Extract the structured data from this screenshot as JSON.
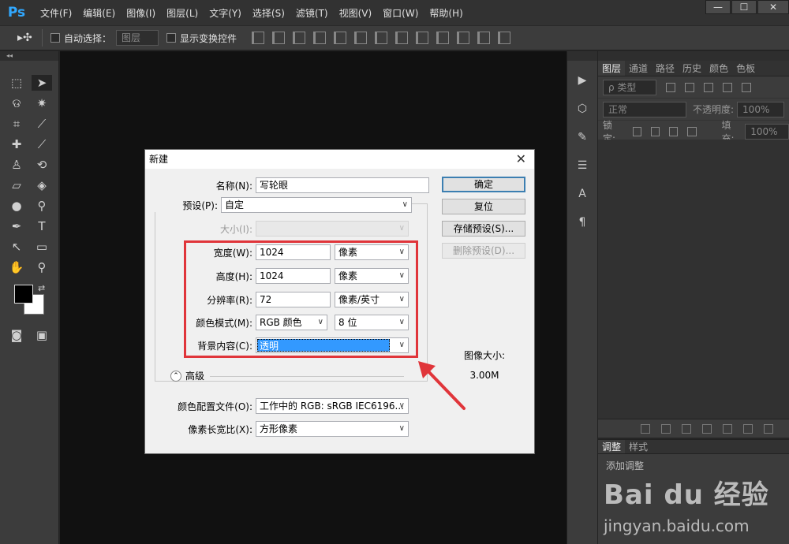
{
  "app": {
    "logo": "Ps",
    "menu": [
      "文件(F)",
      "编辑(E)",
      "图像(I)",
      "图层(L)",
      "文字(Y)",
      "选择(S)",
      "滤镜(T)",
      "视图(V)",
      "窗口(W)",
      "帮助(H)"
    ],
    "window_controls": [
      "—",
      "☐",
      "✕"
    ]
  },
  "options": {
    "tool_glyph": "▸✣",
    "auto_select_label": "自动选择：",
    "auto_select_value": "图层",
    "transform_label": "显示变换控件"
  },
  "layers_panel": {
    "tabs": [
      "图层",
      "通道",
      "路径",
      "历史",
      "颜色",
      "色板"
    ],
    "kind": "ρ 类型",
    "blend": "正常",
    "opacity_label": "不透明度:",
    "opacity_value": "100%",
    "lock_label": "锁定:",
    "fill_label": "填充:",
    "fill_value": "100%"
  },
  "adjust_panel": {
    "tabs": [
      "调整",
      "样式"
    ],
    "hint": "添加调整"
  },
  "watermark": {
    "logo": "Bai du 经验",
    "url": "jingyan.baidu.com"
  },
  "dialog": {
    "title": "新建",
    "name_label": "名称(N):",
    "name_value": "写轮眼",
    "preset_label": "预设(P):",
    "preset_value": "自定",
    "size_label": "大小(I):",
    "width_label": "宽度(W):",
    "width_value": "1024",
    "width_unit": "像素",
    "height_label": "高度(H):",
    "height_value": "1024",
    "height_unit": "像素",
    "resolution_label": "分辨率(R):",
    "resolution_value": "72",
    "resolution_unit": "像素/英寸",
    "color_mode_label": "颜色模式(M):",
    "color_mode_value": "RGB 颜色",
    "bit_depth": "8 位",
    "background_label": "背景内容(C):",
    "background_value": "透明",
    "advanced_label": "高级",
    "profile_label": "颜色配置文件(O):",
    "profile_value": "工作中的 RGB: sRGB IEC6196...",
    "aspect_label": "像素长宽比(X):",
    "aspect_value": "方形像素",
    "ok": "确定",
    "reset": "复位",
    "save_preset": "存储预设(S)...",
    "delete_preset": "删除预设(D)...",
    "image_size_label": "图像大小:",
    "image_size_value": "3.00M"
  },
  "colors": {
    "highlight_red": "#e0353a",
    "selection_blue": "#3399ff"
  }
}
